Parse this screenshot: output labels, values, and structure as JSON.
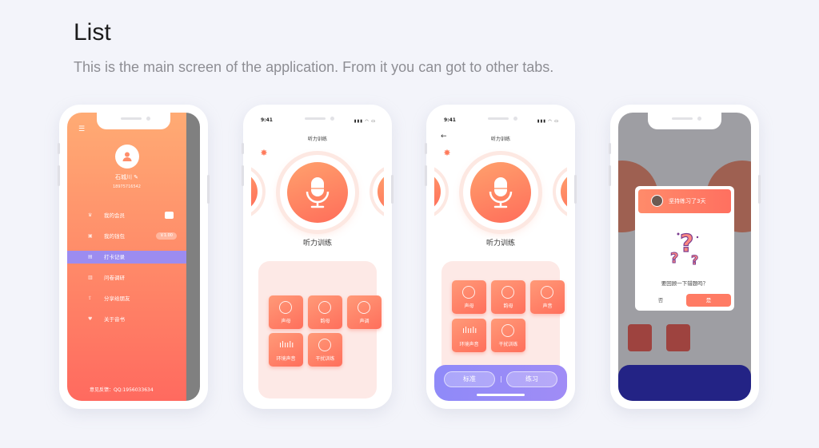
{
  "header": {
    "title": "List",
    "subtitle": "This is the main screen of the application. From it you can got to other tabs."
  },
  "common": {
    "time": "9:41",
    "mic_label": "听力训练",
    "nav_title": "听力训练",
    "tiles": [
      "声母",
      "韵母",
      "声调",
      "环境声音",
      "干扰训练"
    ]
  },
  "drawer": {
    "user_name": "石城川",
    "phone": "18975716542",
    "menu": [
      {
        "label": "我的会员",
        "badge": ""
      },
      {
        "label": "我的钱包",
        "badge": "￥1.00"
      },
      {
        "label": "打卡记录",
        "badge": ""
      },
      {
        "label": "问卷调研",
        "badge": ""
      },
      {
        "label": "分享给朋友",
        "badge": ""
      },
      {
        "label": "关于音书",
        "badge": ""
      }
    ],
    "active_index": 2,
    "feedback": "意见反馈：QQ:1956033634"
  },
  "screen3": {
    "tiles": [
      "声母",
      "韵母",
      "声音",
      "环境声音",
      "干扰训练"
    ],
    "bottom": {
      "left": "标准",
      "right": "练习"
    }
  },
  "dialog": {
    "header": "坚持练习了3天",
    "question": "要回顾一下错题吗？",
    "no": "否",
    "yes": "是"
  },
  "colors": {
    "accent_orange": "#ff7b64",
    "accent_purple": "#9c8cf0",
    "background": "#f3f4fa"
  }
}
